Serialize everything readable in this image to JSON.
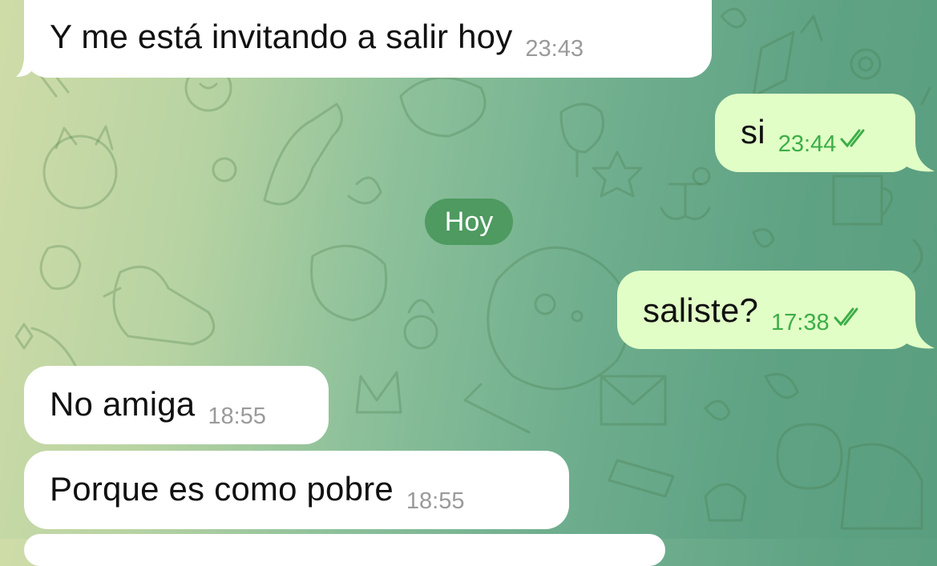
{
  "chat": {
    "messages": [
      {
        "text": "Y me está invitando a salir hoy",
        "time": "23:43",
        "direction": "incoming"
      },
      {
        "text": "si",
        "time": "23:44",
        "direction": "outgoing",
        "status": "read"
      },
      {
        "text": "saliste?",
        "time": "17:38",
        "direction": "outgoing",
        "status": "read"
      },
      {
        "text": "No amiga",
        "time": "18:55",
        "direction": "incoming"
      },
      {
        "text": "Porque es como pobre",
        "time": "18:55",
        "direction": "incoming"
      }
    ],
    "date_separator": "Hoy"
  },
  "colors": {
    "incoming_bubble": "#ffffff",
    "outgoing_bubble": "#e1fec6",
    "outgoing_time": "#3cae48",
    "date_pill": "#4e9a60"
  },
  "icons": [
    "double-check-icon"
  ]
}
